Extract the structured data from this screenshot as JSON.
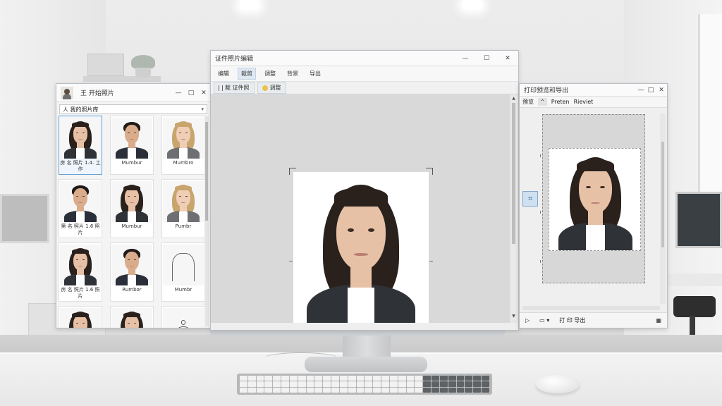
{
  "left_window": {
    "title": "王 开始照片",
    "search_text": "人 我的照片库",
    "controls": [
      "—",
      "□",
      "✕"
    ],
    "thumbnails": [
      {
        "caption": "房 名 照片 1.4. 工作",
        "selected": true,
        "kind": "female-dark"
      },
      {
        "caption": "Mumbur",
        "selected": false,
        "kind": "male-dark"
      },
      {
        "caption": "Mumbro",
        "selected": false,
        "kind": "female-blonde"
      },
      {
        "caption": "第 名 照片 1.6 照片",
        "selected": false,
        "kind": "male-dark"
      },
      {
        "caption": "Mumbur",
        "selected": false,
        "kind": "female-dark"
      },
      {
        "caption": "Pumbr",
        "selected": false,
        "kind": "female-blonde"
      },
      {
        "caption": "房 名 照片 1.6 照片",
        "selected": false,
        "kind": "female-dark"
      },
      {
        "caption": "Rumbor",
        "selected": false,
        "kind": "male-dark"
      },
      {
        "caption": "Mumbr",
        "selected": false,
        "kind": "placeholder"
      },
      {
        "caption": "",
        "selected": false,
        "kind": "female-dark"
      },
      {
        "caption": "",
        "selected": false,
        "kind": "female-dark"
      },
      {
        "caption": "",
        "selected": false,
        "kind": "add-person"
      }
    ]
  },
  "main_window": {
    "title": "证件照片编辑",
    "controls": [
      "—",
      "☐",
      "✕"
    ],
    "menu": [
      "编辑",
      "裁剪",
      "调整",
      "背景",
      "导出"
    ],
    "active_menu_index": 1,
    "toolbar": {
      "crop_label": "裁 证件照",
      "adjust_label": "调整"
    }
  },
  "right_window": {
    "title": "打印预览和导出",
    "controls": [
      "—",
      "□",
      "✕"
    ],
    "tabs": [
      "预览",
      "Preten",
      "Rieviet"
    ],
    "side_tool_icon": "crop-icon",
    "bottom_label": "打 印 导出"
  },
  "colors": {
    "accent": "#6a9fd4",
    "selected_bg": "#eef5fc",
    "window_bg": "#f4f4f4",
    "canvas_bg": "#d9d9d9"
  }
}
